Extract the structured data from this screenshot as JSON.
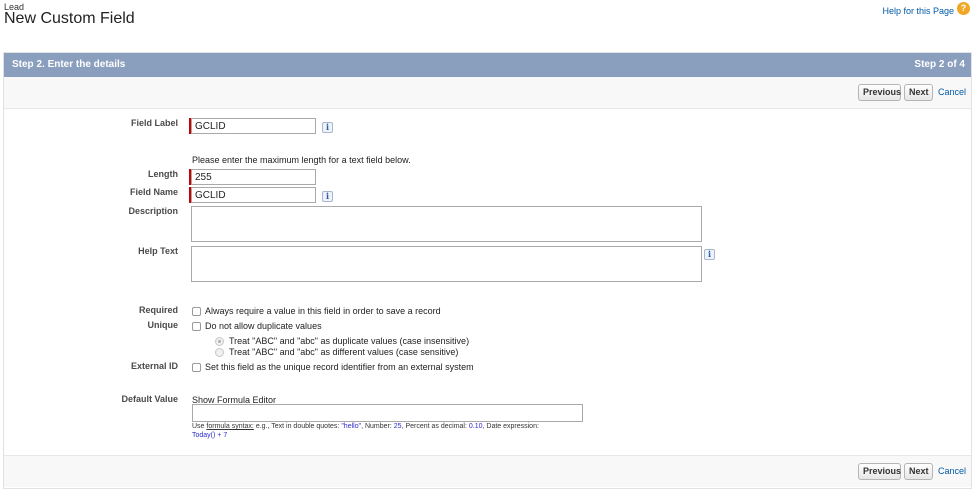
{
  "header": {
    "breadcrumb": "Lead",
    "title": "New Custom Field",
    "help_link": "Help for this Page",
    "help_icon": "?"
  },
  "step": {
    "title": "Step 2. Enter the details",
    "progress": "Step 2 of 4"
  },
  "buttons": {
    "previous": "Previous",
    "next": "Next",
    "cancel": "Cancel"
  },
  "form": {
    "field_label": {
      "label": "Field Label",
      "value": "GCLID"
    },
    "length_hint": "Please enter the maximum length for a text field below.",
    "length": {
      "label": "Length",
      "value": "255"
    },
    "field_name": {
      "label": "Field Name",
      "value": "GCLID"
    },
    "description": {
      "label": "Description",
      "value": ""
    },
    "help_text": {
      "label": "Help Text",
      "value": ""
    },
    "required": {
      "label": "Required",
      "text": "Always require a value in this field in order to save a record",
      "checked": false
    },
    "unique": {
      "label": "Unique",
      "text": "Do not allow duplicate values",
      "checked": false,
      "option_insensitive": "Treat \"ABC\" and \"abc\" as duplicate values (case insensitive)",
      "option_sensitive": "Treat \"ABC\" and \"abc\" as different values (case sensitive)"
    },
    "external_id": {
      "label": "External ID",
      "text": "Set this field as the unique record identifier from an external system",
      "checked": false
    },
    "default_value": {
      "label": "Default Value",
      "formula_link": "Show Formula Editor",
      "value": "",
      "hint_prefix": "Use ",
      "hint_link": "formula syntax:",
      "hint_text1": " e.g., Text in double quotes: ",
      "hint_ex1": "\"hello\"",
      "hint_text2": ", Number: ",
      "hint_ex2": "25",
      "hint_text3": ", Percent as decimal: ",
      "hint_ex3": "0.10",
      "hint_text4": ", Date expression:",
      "hint_ex4": "Today() + 7"
    }
  },
  "info_icon": "i",
  "colors": {
    "header_bar": "#8a9ebe",
    "required_marker": "#cc0000",
    "link": "#015ba7",
    "help_icon": "#f0a724"
  }
}
